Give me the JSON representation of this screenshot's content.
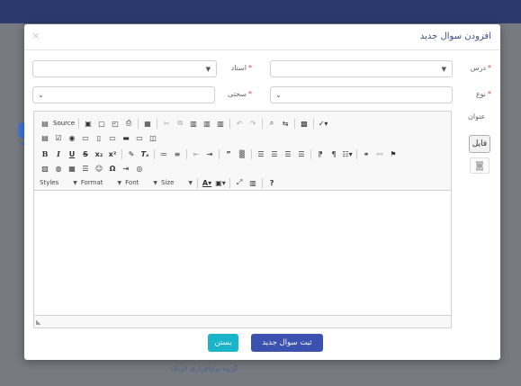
{
  "background": {
    "footer_text": "گروه نرم‌افزاری اترنک"
  },
  "modal": {
    "title": "افزودن سوال جدید",
    "close_glyph": "×"
  },
  "form": {
    "lesson_label": "درس",
    "teacher_label": "استاد",
    "type_label": "نوع",
    "difficulty_label": "سختی",
    "title_label": "عنوان",
    "required_mark": "*",
    "file_button_label": "فایل"
  },
  "editor": {
    "source_label": "Source",
    "styles_label": "Styles",
    "format_label": "Format",
    "font_label": "Font",
    "size_label": "Size"
  },
  "buttons": {
    "close_label": "بستن",
    "submit_label": "ثبت سوال جدید"
  },
  "colors": {
    "primary": "#3d52b0",
    "info": "#1ab5c9",
    "title_text": "#3b4f8a",
    "required": "#e23d3d"
  }
}
